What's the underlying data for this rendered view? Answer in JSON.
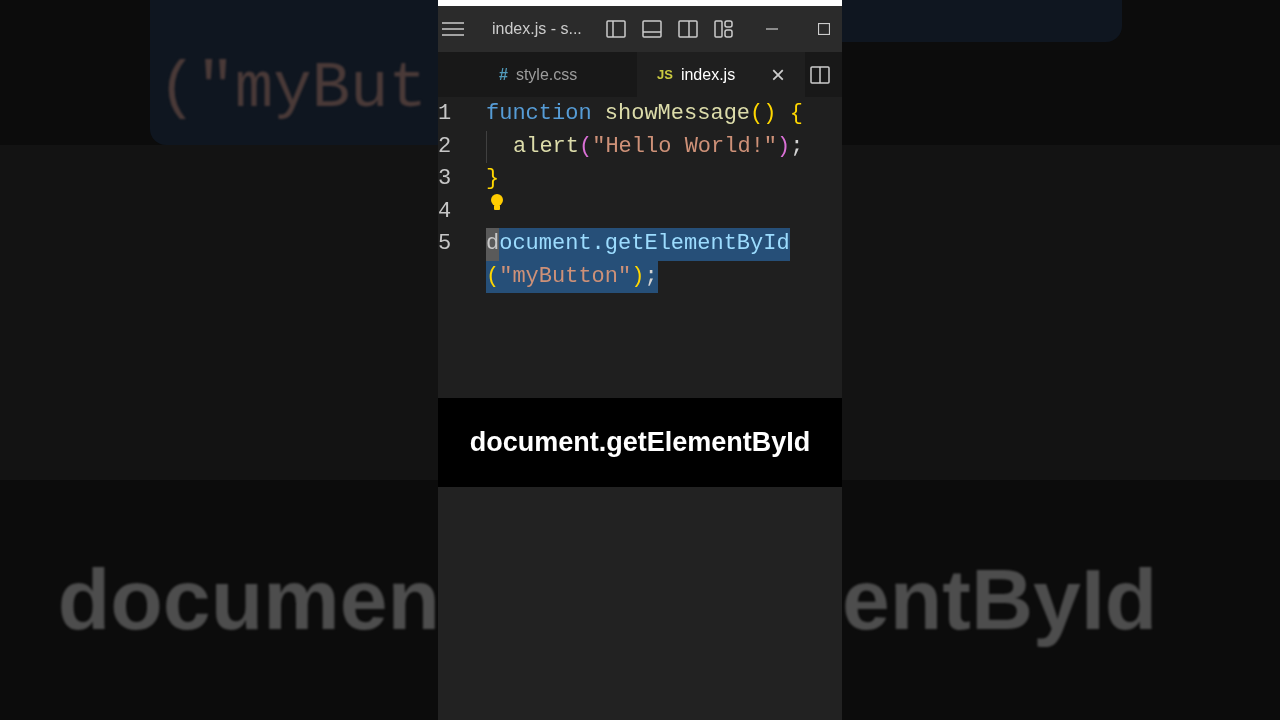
{
  "backdrop": {
    "left_code": "(\"myBut",
    "left_caption": "documen",
    "right_caption": "entById"
  },
  "window": {
    "title": "index.js - s..."
  },
  "tabs": [
    {
      "icon": "#",
      "label": "style.css",
      "selected": false
    },
    {
      "icon": "JS",
      "label": "index.js",
      "selected": true
    }
  ],
  "close_tab": "×",
  "editor": {
    "lines": [
      {
        "number": "1",
        "tokens": [
          {
            "kind": "keyword",
            "text": "function"
          },
          {
            "kind": "function",
            "text": "showMessage"
          },
          {
            "kind": "bracket",
            "text": "()"
          },
          {
            "kind": "bracket",
            "text": "{"
          }
        ]
      },
      {
        "number": "2",
        "indented": true,
        "tokens": [
          {
            "kind": "function",
            "text": "alert"
          },
          {
            "kind": "bracket2",
            "text": "("
          },
          {
            "kind": "string",
            "text": "\"Hello World!\""
          },
          {
            "kind": "bracket2",
            "text": ")"
          },
          {
            "kind": "plain",
            "text": ";"
          }
        ]
      },
      {
        "number": "3",
        "tokens": [
          {
            "kind": "bracket",
            "text": "}"
          }
        ]
      },
      {
        "number": "4",
        "lightbulb": true
      },
      {
        "number": "5",
        "selected": true,
        "tokens": [
          {
            "kind": "cursor",
            "text": "d"
          },
          {
            "kind": "variable",
            "text": "ocument.getElementById"
          },
          {
            "kind": "bracket",
            "text": "("
          },
          {
            "kind": "string",
            "text": "\"myButton\""
          },
          {
            "kind": "bracket",
            "text": ")"
          },
          {
            "kind": "plain",
            "text": ";"
          }
        ]
      }
    ]
  },
  "caption": "document.getElementById"
}
